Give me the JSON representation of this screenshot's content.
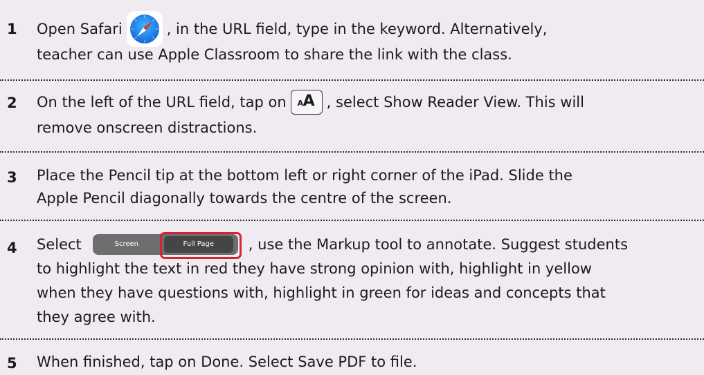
{
  "steps": [
    {
      "number": "1",
      "text_before_icon": "Open Safari",
      "icon": "safari-icon",
      "text_after_icon": ", in the URL field, type in the keyword. Alternatively,",
      "line2": "teacher can use Apple Classroom to share the link with the class."
    },
    {
      "number": "2",
      "text_before_icon": "On the left of the URL field, tap on",
      "icon": "reader-view-aa-icon",
      "aa_small": "A",
      "aa_big": "A",
      "text_after_icon": ", select Show Reader View. This will",
      "line2": "remove onscreen distractions."
    },
    {
      "number": "3",
      "line1": "Place the Pencil tip at the bottom left or right corner of the iPad. Slide the",
      "line2": "Apple Pencil diagonally towards the centre of the screen."
    },
    {
      "number": "4",
      "text_before_control": "Select",
      "control": {
        "option1": "Screen",
        "option2": "Full Page",
        "highlight_color": "#d5232f"
      },
      "text_after_control": ", use the Markup tool to annotate. Suggest students",
      "line2": "to highlight the text in red they have strong opinion with, highlight in yellow",
      "line3": "when they have questions with, highlight in green for ideas and concepts that",
      "line4": "they agree with."
    },
    {
      "number": "5",
      "line1": "When finished, tap on Done. Select Save PDF to file."
    }
  ],
  "colors": {
    "background": "#efebf1",
    "text": "#1a1a1a",
    "safari_blue": "#1f8ef1"
  }
}
